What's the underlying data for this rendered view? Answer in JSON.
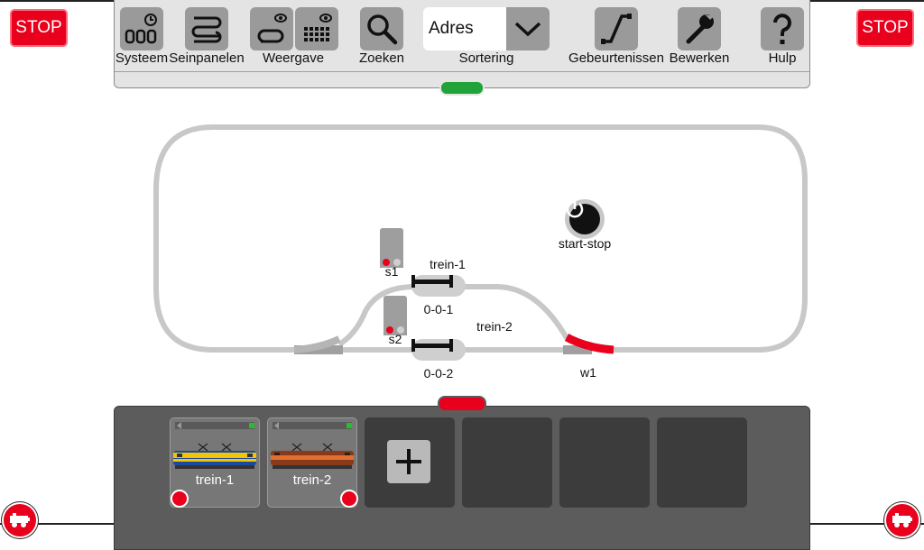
{
  "stop": {
    "left_label": "STOP",
    "right_label": "STOP"
  },
  "toolbar": {
    "system_label": "Systeem",
    "signal_panels_label": "Seinpanelen",
    "view_label": "Weergave",
    "search_label": "Zoeken",
    "sort_label": "Sortering",
    "address_value": "Adres",
    "events_label": "Gebeurtenissen",
    "edit_label": "Bewerken",
    "help_label": "Hulp"
  },
  "layout": {
    "track_color": "#c8c8c8",
    "turnout_active_color": "#e8001c",
    "start_stop_label": "start-stop",
    "signals": [
      {
        "label": "s1",
        "state": "red"
      },
      {
        "label": "s2",
        "state": "red"
      }
    ],
    "trains": [
      {
        "label": "trein-1"
      },
      {
        "label": "trein-2"
      }
    ],
    "blocks": [
      {
        "label": "0-0-1"
      },
      {
        "label": "0-0-2"
      }
    ],
    "turnout": {
      "label": "w1"
    }
  },
  "loco_panel": {
    "locos": [
      {
        "name": "trein-1",
        "livery": "yellow-blue"
      },
      {
        "name": "trein-2",
        "livery": "red-orange"
      }
    ],
    "add_icon": "plus-icon"
  },
  "colors": {
    "accent_red": "#e8001c",
    "handle_green": "#22a33a",
    "toolbar_bg": "#e4e4e4",
    "panel_bg": "#5c5c5c"
  }
}
